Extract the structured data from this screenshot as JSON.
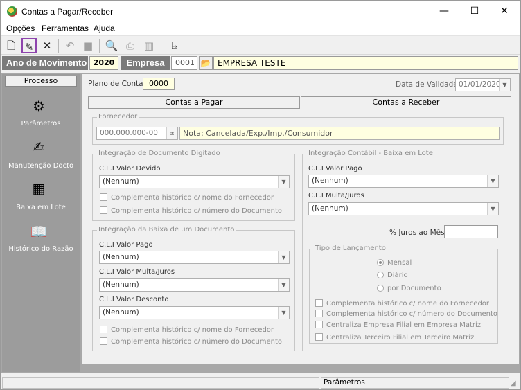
{
  "window": {
    "title": "Contas a Pagar/Receber",
    "minimize": "—",
    "maximize": "☐",
    "close": "✕"
  },
  "menu": [
    "Opções",
    "Ferramentas",
    "Ajuda"
  ],
  "toolbar": {
    "icons": [
      "new-document-icon",
      "edit-document-icon",
      "delete-icon",
      "undo-icon",
      "stop-icon",
      "print-preview-icon",
      "print-icon",
      "export-icon",
      "exit-door-icon"
    ]
  },
  "year_bar": {
    "year_label": "Ano de Movimento",
    "year": "2020",
    "company_label": "Empresa",
    "company_code": "0001",
    "company_name": "EMPRESA TESTE"
  },
  "sidebar": {
    "header": "Processo",
    "items": [
      "Parâmetros",
      "Manutenção Docto",
      "Baixa em Lote",
      "Histórico do Razão"
    ]
  },
  "top": {
    "plano_label": "Plano de Contas",
    "plano_value": "0000",
    "validade_label": "Data de Validade",
    "validade_value": "01/01/2020"
  },
  "tabs": [
    "Contas a Pagar",
    "Contas a Receber"
  ],
  "fornecedor": {
    "label": "Fornecedor",
    "code": "000.000.000-00",
    "note": "Nota: Cancelada/Exp./Imp./Consumidor"
  },
  "integ_doc": {
    "label": "Integração de Documento Digitado",
    "cli_devido_label": "C.L.I Valor Devido",
    "cli_devido_value": "(Nenhum)",
    "chk1": "Complementa histórico c/ nome do Fornecedor",
    "chk2": "Complementa histórico c/ número do Documento"
  },
  "integ_baixa": {
    "label": "Integração da Baixa de um Documento",
    "pago_label": "C.L.I Valor Pago",
    "pago_value": "(Nenhum)",
    "multa_label": "C.L.I Valor Multa/Juros",
    "multa_value": "(Nenhum)",
    "desconto_label": "C.L.I Valor Desconto",
    "desconto_value": "(Nenhum)",
    "chk1": "Complementa histórico c/ nome do Fornecedor",
    "chk2": "Complementa histórico c/ número do Documento"
  },
  "integ_contabil": {
    "label": "Integração Contábil - Baixa em Lote",
    "pago_label": "C.L.I Valor Pago",
    "pago_value": "(Nenhum)",
    "multa_label": "C.L.I Multa/Juros",
    "multa_value": "(Nenhum)",
    "juros_label": "% Juros ao Mês",
    "juros_value": ""
  },
  "tipo_lanc": {
    "label": "Tipo de Lançamento",
    "radios": [
      "Mensal",
      "Diário",
      "por Documento"
    ],
    "selected": "Mensal",
    "chk1": "Complementa histórico c/ nome do Fornecedor",
    "chk2": "Complementa histórico c/ número do Documento",
    "chk3": "Centraliza Empresa Filial em Empresa Matriz",
    "chk4": "Centraliza Terceiro Filial em Terceiro Matriz"
  },
  "status": {
    "left": "",
    "right": "Parâmetros"
  }
}
